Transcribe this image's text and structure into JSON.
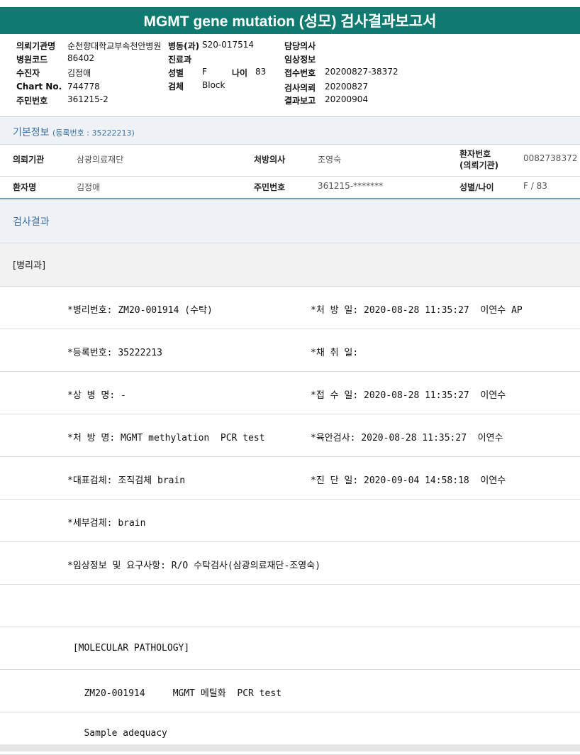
{
  "title": "MGMT gene mutation (성모) 검사결과보고서",
  "header": {
    "request_inst_label": "의뢰기관명",
    "request_inst_value": "순천향대학교부속천안병원",
    "ward_label": "병동(과)",
    "ward_value": "S20-017514",
    "doctor_label": "담당의사",
    "hospital_code_label": "병원코드",
    "hospital_code_value": "86402",
    "dept_label": "진료과",
    "clinical_info_label": "임상정보",
    "patient_label": "수진자",
    "patient_value": "김정애",
    "sex_label": "성별",
    "sex_value": "F",
    "age_label": "나이",
    "age_value": "83",
    "receipt_label": "접수번호",
    "receipt_value": "20200827-38372",
    "chart_label": "Chart No.",
    "chart_value": "744778",
    "specimen_label": "검체",
    "specimen_value": "Block",
    "test_req_label": "검사의뢰",
    "test_req_value": "20200827",
    "ssn_label": "주민번호",
    "ssn_value": "361215-2",
    "report_label": "결과보고",
    "report_value": "20200904"
  },
  "basic": {
    "title": "기본정보",
    "reg_no": "(등록번호 : 35222213)",
    "row1": {
      "k1": "의뢰기관",
      "v1": "삼광의료재단",
      "k2": "처방의사",
      "v2": "조영숙",
      "k3a": "환자번호",
      "k3b": "(의뢰기관)",
      "v3": "0082738372"
    },
    "row2": {
      "k1": "환자명",
      "v1": "김정애",
      "k2": "주민번호",
      "v2": "361215-*******",
      "k3": "성별/나이",
      "v3": "F / 83"
    }
  },
  "results": {
    "title": "검사결과",
    "dept": "[병리과]",
    "rows": [
      {
        "left": "*병리번호: ZM20-001914 (수탁)",
        "right": "*처 방 일: 2020-08-28 11:35:27  이연수 AP"
      },
      {
        "left": "*등록번호: 35222213",
        "right": "*채 취 일:"
      },
      {
        "left": "*상 병 명: -",
        "right": "*접 수 일: 2020-08-28 11:35:27  이연수"
      },
      {
        "left": "*처 방 명: MGMT methylation  PCR test",
        "right": "*육안검사: 2020-08-28 11:35:27  이연수"
      },
      {
        "left": "*대표검체: 조직검체 brain",
        "right": "*진 단 일: 2020-09-04 14:58:18  이연수"
      },
      {
        "left": "*세부검체: brain",
        "right": ""
      },
      {
        "left": "*임상정보 및 요구사항: R/O 수탁검사(삼광의료재단-조영숙)",
        "right": ""
      },
      {
        "left": "",
        "right": ""
      },
      {
        "left": " [MOLECULAR PATHOLOGY]",
        "right": ""
      },
      {
        "left": "   ZM20-001914     MGMT 메틸화  PCR test",
        "right": ""
      },
      {
        "left": "   Sample adequacy",
        "right": ""
      }
    ]
  }
}
